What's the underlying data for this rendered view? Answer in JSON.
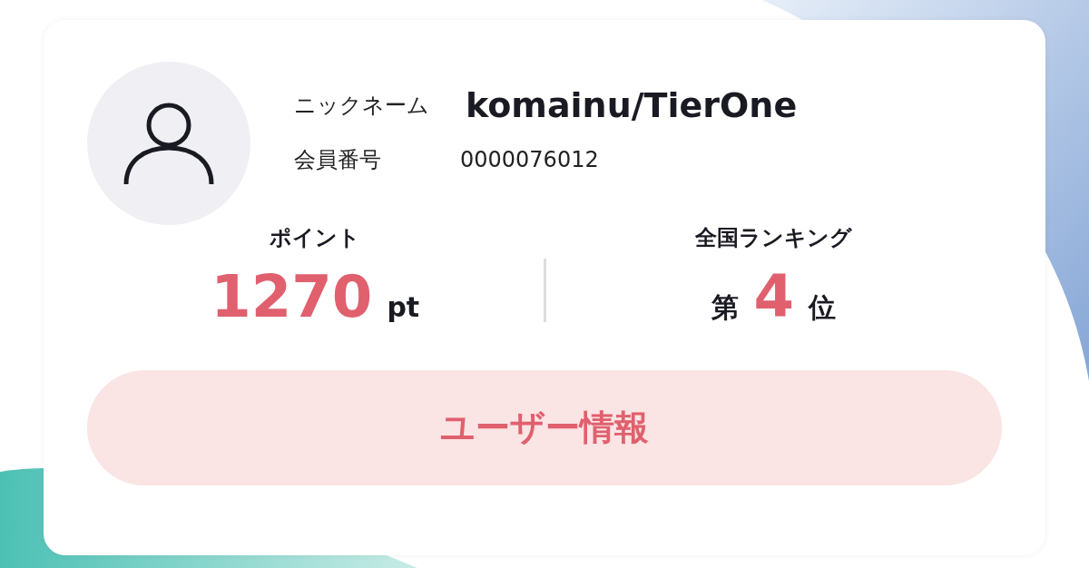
{
  "profile": {
    "nickname_label": "ニックネーム",
    "nickname": "komainu/TierOne",
    "member_label": "会員番号",
    "member_number": "0000076012"
  },
  "stats": [
    {
      "kind": "points",
      "label": "ポイント",
      "value": "1270",
      "unit": "pt"
    },
    {
      "kind": "rank",
      "label": "全国ランキング",
      "prefix": "第",
      "value": "4",
      "unit": "位"
    }
  ],
  "button": {
    "label": "ユーザー情報"
  }
}
